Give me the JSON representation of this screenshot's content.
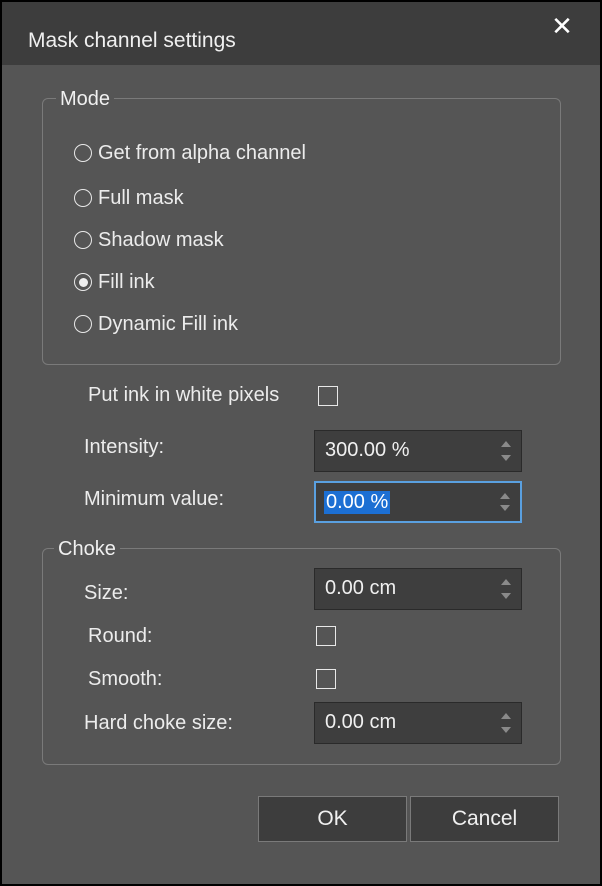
{
  "dialog": {
    "title": "Mask channel settings",
    "close_glyph": "✕"
  },
  "mode": {
    "legend": "Mode",
    "options": [
      {
        "label": "Get from alpha channel",
        "selected": false
      },
      {
        "label": "Full mask",
        "selected": false
      },
      {
        "label": "Shadow mask",
        "selected": false
      },
      {
        "label": "Fill ink",
        "selected": true
      },
      {
        "label": "Dynamic Fill ink",
        "selected": false
      }
    ]
  },
  "put_ink": {
    "label": "Put ink in white pixels",
    "checked": false
  },
  "intensity": {
    "label": "Intensity:",
    "value": "300.00 %"
  },
  "minimum": {
    "label": "Minimum value:",
    "value": "0.00 %"
  },
  "choke": {
    "legend": "Choke",
    "size": {
      "label": "Size:",
      "value": "0.00 cm"
    },
    "round": {
      "label": "Round:",
      "checked": false
    },
    "smooth": {
      "label": "Smooth:",
      "checked": false
    },
    "hard": {
      "label": "Hard choke size:",
      "value": "0.00 cm"
    }
  },
  "buttons": {
    "ok": "OK",
    "cancel": "Cancel"
  },
  "colors": {
    "window_bg": "#555555",
    "title_bg": "#3d3d3d",
    "focus": "#5aa0e0",
    "selection": "#1c6fd3"
  }
}
